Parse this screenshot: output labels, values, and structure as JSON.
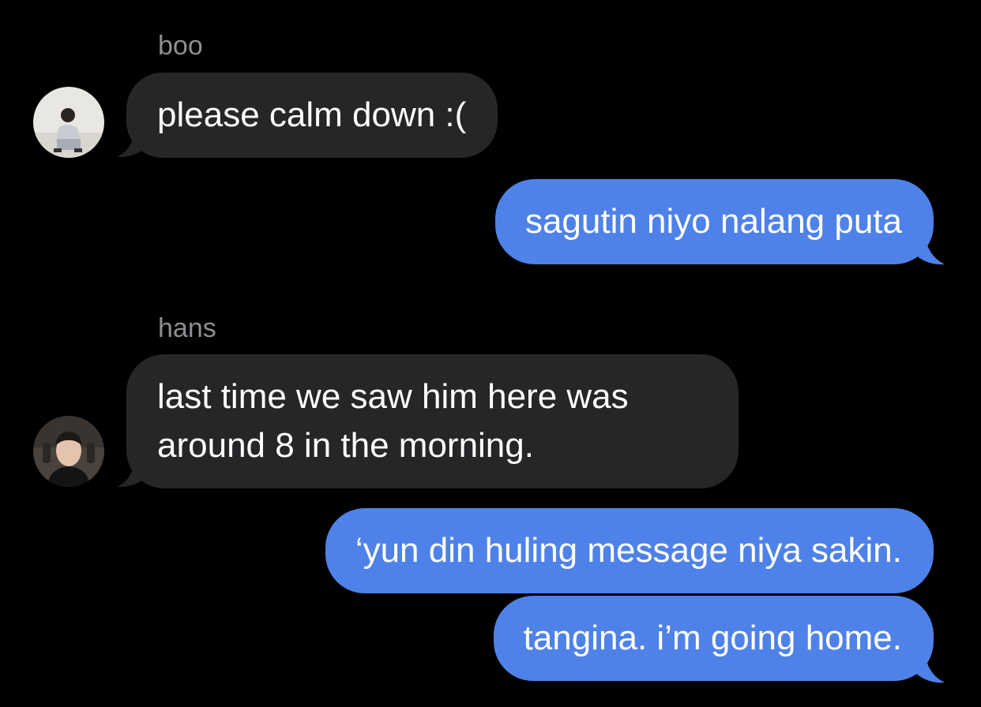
{
  "conversation": {
    "messages": [
      {
        "direction": "incoming",
        "sender": "boo",
        "text": "please calm down :("
      },
      {
        "direction": "outgoing",
        "text": "sagutin niyo nalang puta"
      },
      {
        "direction": "incoming",
        "sender": "hans",
        "text": "last time we saw him here was around 8 in the morning."
      },
      {
        "direction": "outgoing",
        "text": "‘yun din huling message niya sakin."
      },
      {
        "direction": "outgoing",
        "text": "tangina. i’m going home."
      }
    ]
  },
  "colors": {
    "background": "#000000",
    "incoming_bubble": "#262629",
    "outgoing_bubble": "#4f82e8",
    "sender_name": "#8e8e93",
    "text": "#ffffff"
  },
  "icons": {
    "boo_avatar": "avatar-photo",
    "hans_avatar": "avatar-photo"
  }
}
